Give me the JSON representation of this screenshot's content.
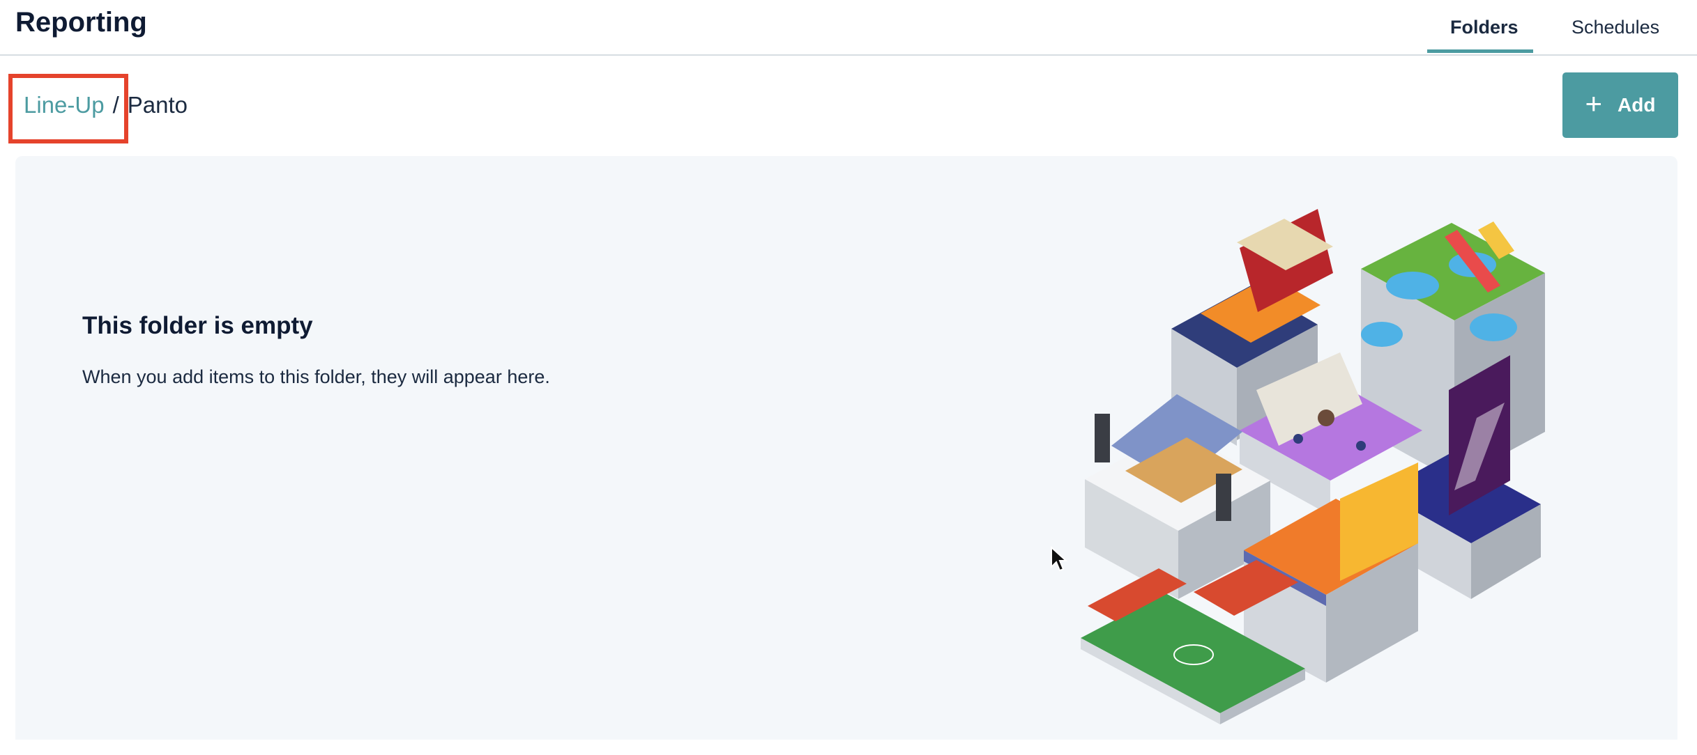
{
  "header": {
    "title": "Reporting"
  },
  "tabs": [
    {
      "label": "Folders",
      "active": true
    },
    {
      "label": "Schedules",
      "active": false
    }
  ],
  "breadcrumb": {
    "parent": "Line-Up",
    "separator": "/",
    "current": "Panto"
  },
  "toolbar": {
    "add_label": "Add"
  },
  "empty_state": {
    "title": "This folder is empty",
    "message": "When you add items to this folder, they will appear here."
  },
  "colors": {
    "accent": "#4c9ba1",
    "highlight": "#e5432c",
    "panel": "#f4f7fa",
    "text": "#0f1b33"
  }
}
